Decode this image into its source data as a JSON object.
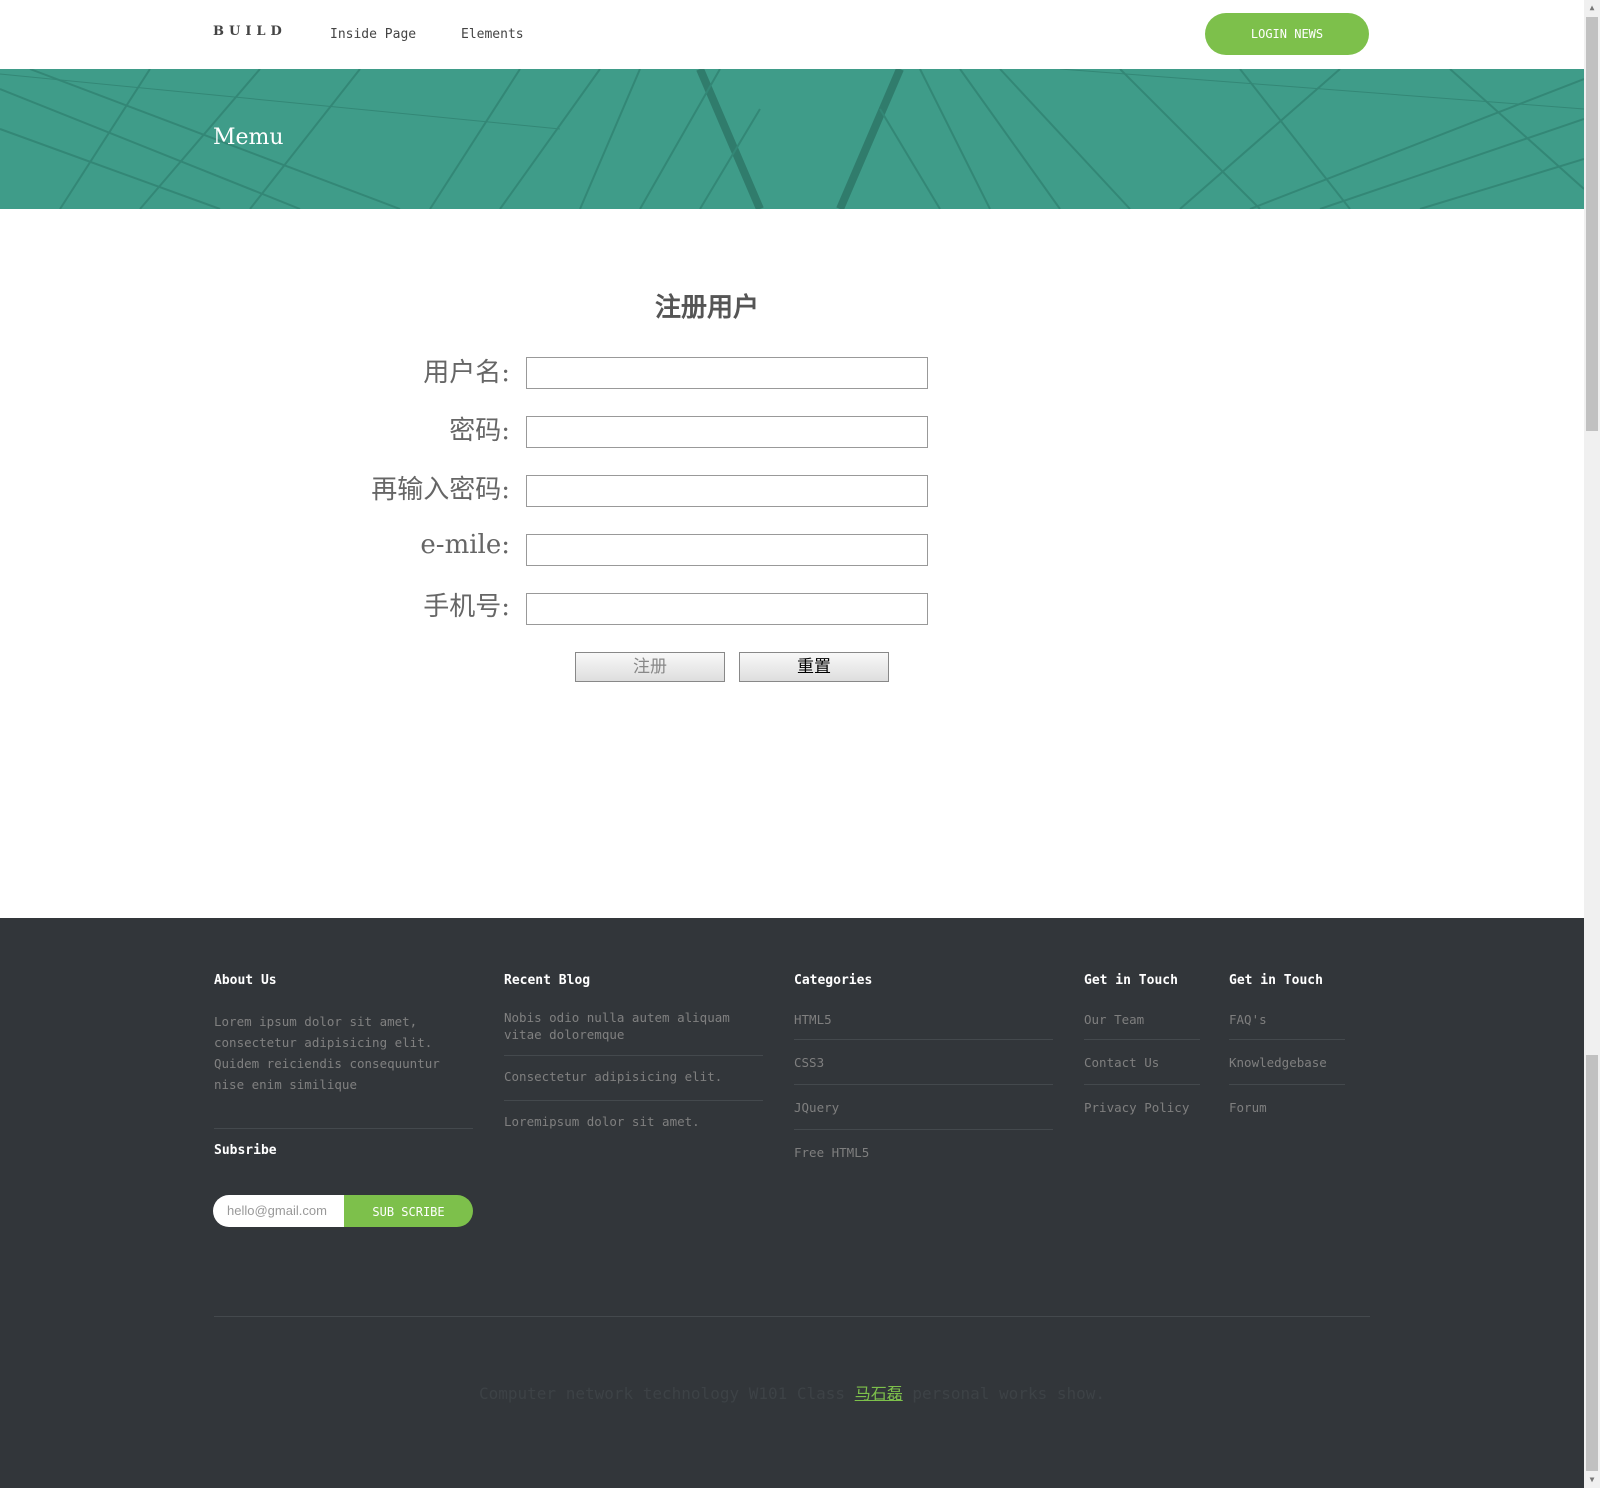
{
  "header": {
    "brand": "BUILD",
    "nav": [
      "Inside Page",
      "Elements"
    ],
    "login_button": "LOGIN NEWS"
  },
  "hero": {
    "title": "Memu"
  },
  "form": {
    "title": "注册用户",
    "fields": [
      {
        "label": "用户名:",
        "value": ""
      },
      {
        "label": "密码:",
        "value": ""
      },
      {
        "label": "再输入密码:",
        "value": ""
      },
      {
        "label": "e-mile:",
        "value": ""
      },
      {
        "label": "手机号:",
        "value": ""
      }
    ],
    "submit_label": "注册",
    "reset_label": "重置"
  },
  "footer": {
    "about": {
      "heading": "About Us",
      "text": "Lorem ipsum dolor sit amet, consectetur adipisicing elit. Quidem reiciendis consequuntur nise enim similique"
    },
    "subscribe": {
      "heading": "Subsribe",
      "placeholder": "hello@gmail.com",
      "button": "SUB SCRIBE"
    },
    "recent_blog": {
      "heading": "Recent Blog",
      "items": [
        "Nobis odio nulla autem aliquam vitae doloremque",
        "Consectetur adipisicing elit.",
        "Loremipsum dolor sit amet."
      ]
    },
    "categories": {
      "heading": "Categories",
      "items": [
        "HTML5",
        "CSS3",
        "JQuery",
        "Free HTML5"
      ]
    },
    "get_in_touch_1": {
      "heading": "Get in Touch",
      "items": [
        "Our Team",
        "Contact Us",
        "Privacy Policy"
      ]
    },
    "get_in_touch_2": {
      "heading": "Get in Touch",
      "items": [
        "FAQ's",
        "Knowledgebase",
        "Forum"
      ]
    },
    "copyright": {
      "prefix": "Computer network technology W101 Class",
      "author": "马石磊",
      "suffix": "personal works show."
    }
  },
  "colors": {
    "accent": "#7dc04b",
    "hero": "#3f9c89",
    "footer_bg": "#32363a"
  }
}
